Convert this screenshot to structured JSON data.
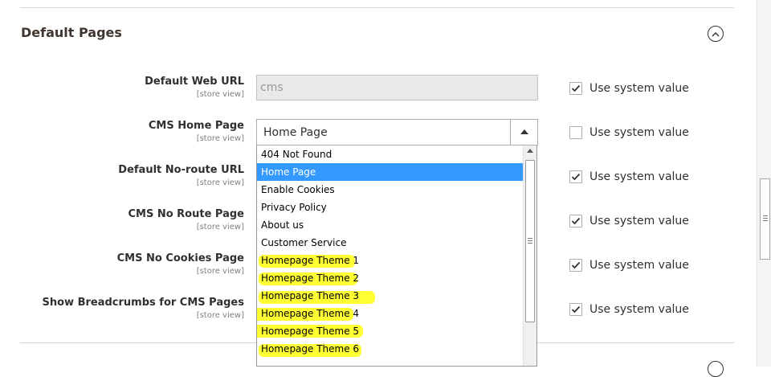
{
  "section": {
    "title": "Default Pages",
    "collapse_icon": "chevron-up-circle-icon",
    "next_section_icon": "chevron-circle-icon"
  },
  "fields": [
    {
      "label": "Default Web URL",
      "scope": "[store view]",
      "value": "cms",
      "use_system_value": true
    },
    {
      "label": "CMS Home Page",
      "scope": "[store view]",
      "value": "Home Page",
      "use_system_value": false
    },
    {
      "label": "Default No-route URL",
      "scope": "[store view]",
      "use_system_value": true
    },
    {
      "label": "CMS No Route Page",
      "scope": "[store view]",
      "use_system_value": true
    },
    {
      "label": "CMS No Cookies Page",
      "scope": "[store view]",
      "use_system_value": true
    },
    {
      "label": "Show Breadcrumbs for CMS Pages",
      "scope": "[store view]",
      "use_system_value": true
    }
  ],
  "use_system_value_label": "Use system value",
  "dropdown": {
    "selected": "Home Page",
    "options": [
      "404 Not Found",
      "Home Page",
      "Enable Cookies",
      "Privacy Policy",
      "About us",
      "Customer Service",
      "Homepage Theme 1",
      "Homepage Theme 2",
      "Homepage Theme 3",
      "Homepage Theme 4",
      "Homepage Theme 5",
      "Homepage Theme 6"
    ],
    "highlight_color": "#ffff33",
    "selected_color": "#3399ff"
  }
}
